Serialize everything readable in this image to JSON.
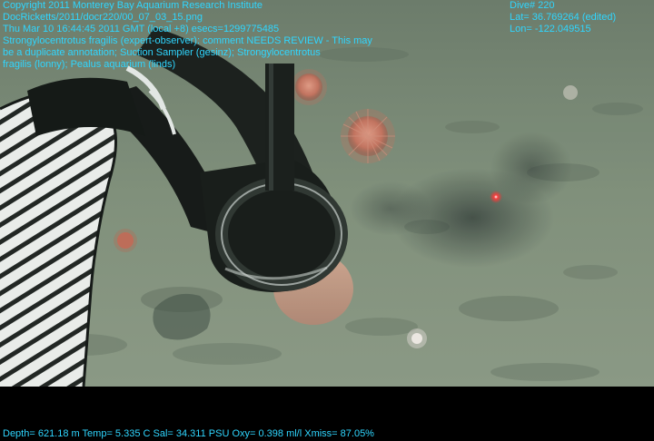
{
  "overlay": {
    "text_color": "#2fd6ff",
    "top_left_lines": [
      "Copyright 2011 Monterey Bay Aquarium Research Institute",
      "DocRicketts/2011/docr220/00_07_03_15.png",
      "Thu Mar 10 16:44:45 2011 GMT (local +8)  esecs=1299775485",
      "Strongylocentrotus fragilis (expert-observer): comment NEEDS REVIEW - This may",
      "be a duplicate annotation; Suction Sampler (gesinz); Strongylocentrotus",
      "fragilis (lonny); Pealus aquarium (linds)"
    ],
    "top_right_lines": [
      "Dive# 220",
      "Lat= 36.769264 (edited)",
      "Lon= -122.049515"
    ],
    "bottom_line": "Depth= 621.18 m  Temp= 5.335 C  Sal= 34.311 PSU  Oxy= 0.398 ml/l  Xmiss= 87.05%"
  },
  "scene": {
    "colors": {
      "seafloor": "#7f8f7a",
      "seafloor_dark": "#5d6c5c",
      "laser": "#ff2a2a",
      "urchin": "#c96f5a",
      "hose_white": "#e8ecea",
      "hose_dark": "#1a1e1c",
      "sampler": "#141816"
    }
  }
}
